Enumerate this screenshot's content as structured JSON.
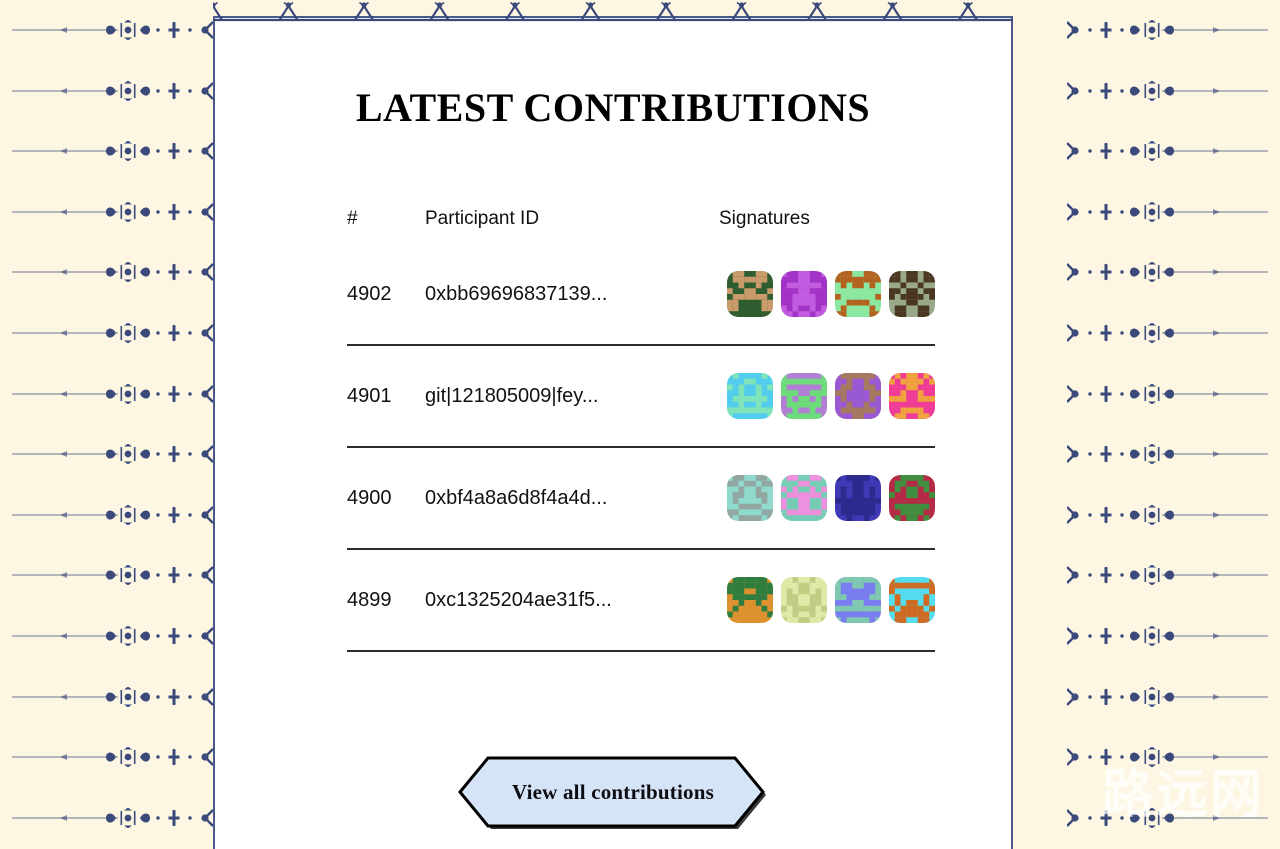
{
  "page": {
    "title": "LATEST CONTRIBUTIONS",
    "background_color": "#fdf6e3",
    "panel_color": "#ffffff",
    "ornament_color": "#3b4a7a",
    "watermark": "路远网"
  },
  "table": {
    "headers": {
      "rank": "#",
      "participant": "Participant ID",
      "signatures": "Signatures"
    },
    "rows": [
      {
        "rank": "4902",
        "participant_id": "0xbb69696837139...",
        "avatars": [
          {
            "bg": "#2f5d2f",
            "fg": "#c99a6a",
            "seed": 41
          },
          {
            "bg": "#a233c6",
            "fg": "#c25ce0",
            "seed": 12
          },
          {
            "bg": "#8ce8a0",
            "fg": "#b4621f",
            "seed": 77
          },
          {
            "bg": "#9aa98a",
            "fg": "#4a3722",
            "seed": 58
          }
        ]
      },
      {
        "rank": "4901",
        "participant_id": "git|121805009|fey...",
        "avatars": [
          {
            "bg": "#53cdee",
            "fg": "#7fe4b8",
            "seed": 23
          },
          {
            "bg": "#b17fd4",
            "fg": "#6ddc7a",
            "seed": 91
          },
          {
            "bg": "#a4795f",
            "fg": "#9a59d4",
            "seed": 35
          },
          {
            "bg": "#ef3d96",
            "fg": "#f0a23e",
            "seed": 64
          }
        ]
      },
      {
        "rank": "4900",
        "participant_id": "0xbf4a8a6d8f4a4d...",
        "avatars": [
          {
            "bg": "#8fd9cd",
            "fg": "#93a6a2",
            "seed": 17
          },
          {
            "bg": "#74cdb4",
            "fg": "#ef90de",
            "seed": 83
          },
          {
            "bg": "#4039b5",
            "fg": "#2b2b8e",
            "seed": 50
          },
          {
            "bg": "#b52b46",
            "fg": "#3f8f3f",
            "seed": 29
          }
        ]
      },
      {
        "rank": "4899",
        "participant_id": "0xc1325204ae31f5...",
        "avatars": [
          {
            "bg": "#dd922f",
            "fg": "#2f7d3f",
            "seed": 70
          },
          {
            "bg": "#c0cd83",
            "fg": "#dfeaa8",
            "seed": 45
          },
          {
            "bg": "#7a7df0",
            "fg": "#7fc9b0",
            "seed": 8
          },
          {
            "bg": "#55dcee",
            "fg": "#cf6a22",
            "seed": 96
          }
        ]
      }
    ]
  },
  "cta": {
    "label": "View all contributions",
    "fill_color": "#d6e4f7",
    "border_color": "#000000"
  }
}
